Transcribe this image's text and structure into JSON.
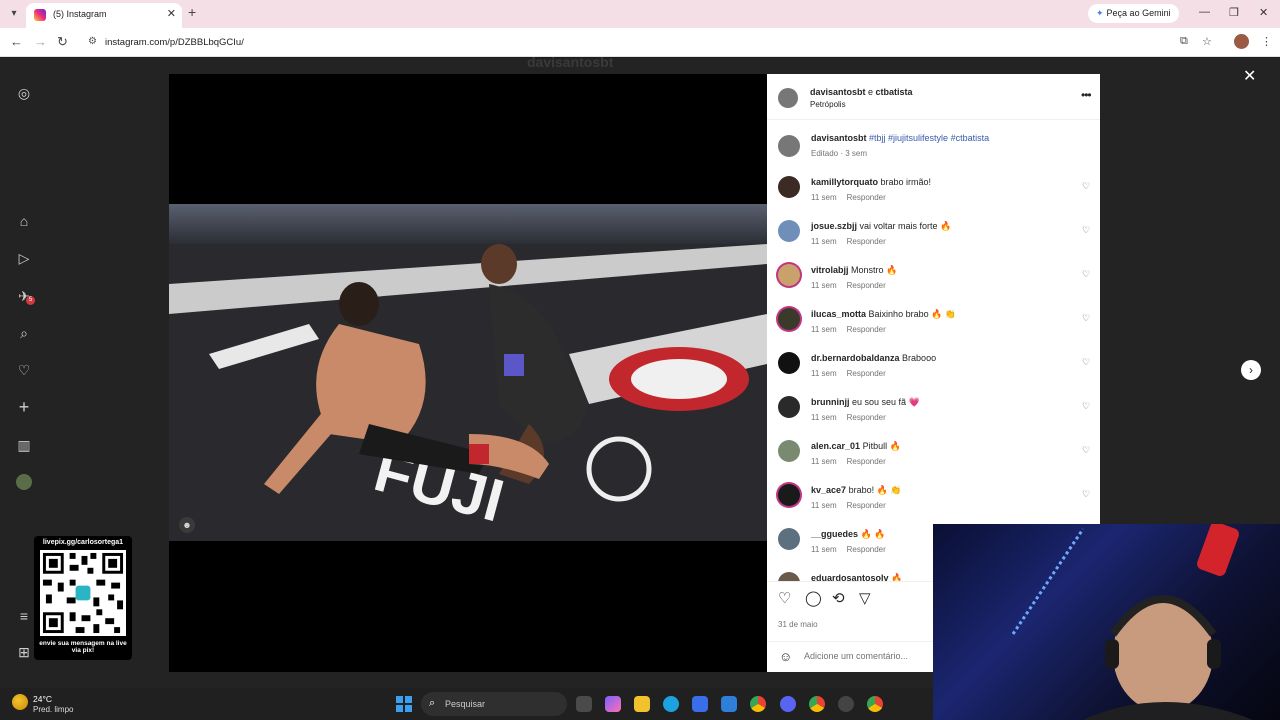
{
  "browser": {
    "tab_title": "(5) Instagram",
    "new_tab": "+",
    "gemini_label": "Peça ao Gemini",
    "url": "instagram.com/p/DZBBLbqGCIu/"
  },
  "background": {
    "username": "davisantosbt"
  },
  "sidebar": {
    "notification_badge": "5"
  },
  "post": {
    "header_user1": "davisantosbt",
    "header_and": " e ",
    "header_user2": "ctbatista",
    "location": "Petrópolis",
    "caption_user": "davisantosbt",
    "caption_tags": "#tbjj #jiujitsulifestyle #ctbatista",
    "caption_meta": "Editado · 3 sem",
    "date": "31 de maio",
    "add_comment_placeholder": "Adicione um comentário..."
  },
  "comments": [
    {
      "user": "kamillytorquato",
      "text": "brabo irmão!",
      "time": "11 sem",
      "reply": "Responder"
    },
    {
      "user": "josue.szbjj",
      "text": "vai voltar mais forte 🔥",
      "time": "11 sem",
      "reply": "Responder"
    },
    {
      "user": "vitrolabjj",
      "text": "Monstro 🔥",
      "time": "11 sem",
      "reply": "Responder"
    },
    {
      "user": "ilucas_motta",
      "text": "Baixinho brabo 🔥 👏",
      "time": "11 sem",
      "reply": "Responder"
    },
    {
      "user": "dr.bernardobaldanza",
      "text": "Brabooo",
      "time": "11 sem",
      "reply": "Responder"
    },
    {
      "user": "brunninjj",
      "text": "eu sou seu fã 💗",
      "time": "11 sem",
      "reply": "Responder"
    },
    {
      "user": "alen.car_01",
      "text": "Pitbull 🔥",
      "time": "11 sem",
      "reply": "Responder"
    },
    {
      "user": "kv_ace7",
      "text": "brabo! 🔥 👏",
      "time": "11 sem",
      "reply": "Responder"
    },
    {
      "user": "__gguedes",
      "text": "🔥 🔥",
      "time": "11 sem",
      "reply": "Responder"
    },
    {
      "user": "eduardosantosolv",
      "text": "🔥",
      "time": "",
      "reply": ""
    }
  ],
  "qr_overlay": {
    "url": "livepix.gg/carlosortega1",
    "message": "envie sua mensagem na live via pix!"
  },
  "taskbar": {
    "temperature": "24°C",
    "weather": "Pred. limpo",
    "search_placeholder": "Pesquisar"
  },
  "colors": {
    "tab_bar": "#f4dfe6",
    "link_blue": "#3a5ba8",
    "windows_blue": "#3c9ef0"
  }
}
